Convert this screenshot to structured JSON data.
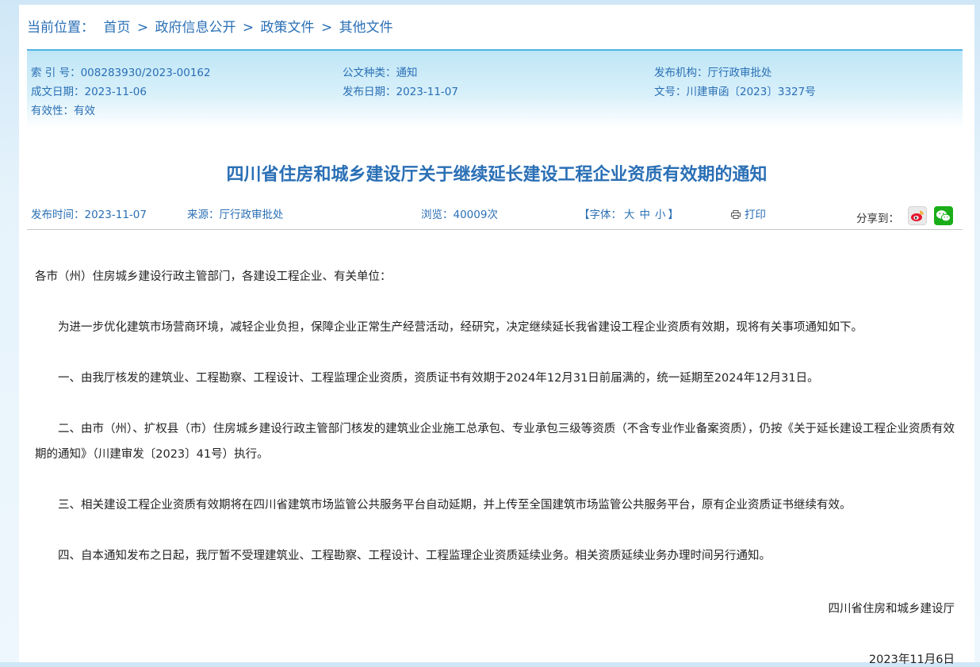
{
  "breadcrumb": {
    "label": "当前位置：",
    "items": [
      "首页",
      "政府信息公开",
      "政策文件",
      "其他文件"
    ],
    "sep": ">"
  },
  "meta": {
    "index_no": "索 引 号：008283930/2023-00162",
    "doc_type": "公文种类：通知",
    "publisher": "发布机构：厅行政审批处",
    "written_date": "成文日期：2023-11-06",
    "publish_date": "发布日期：2023-11-07",
    "doc_no": "文号：川建审函〔2023〕3327号",
    "validity": "有效性：有效"
  },
  "article": {
    "title": "四川省住房和城乡建设厅关于继续延长建设工程企业资质有效期的通知",
    "publish_time": "发布时间：2023-11-07",
    "source": "来源：厅行政审批处",
    "views": "浏览：40009次",
    "font_label_open": "【字体：",
    "font_large": "大",
    "font_medium": "中",
    "font_small": "小",
    "font_label_close": "】",
    "print_label": "打印",
    "share_label": "分享到：",
    "paragraphs": {
      "greeting": "各市（州）住房城乡建设行政主管部门，各建设工程企业、有关单位：",
      "p1": "为进一步优化建筑市场营商环境，减轻企业负担，保障企业正常生产经营活动，经研究，决定继续延长我省建设工程企业资质有效期，现将有关事项通知如下。",
      "p2": "一、由我厅核发的建筑业、工程勘察、工程设计、工程监理企业资质，资质证书有效期于2024年12月31日前届满的，统一延期至2024年12月31日。",
      "p3": "二、由市（州）、扩权县（市）住房城乡建设行政主管部门核发的建筑业企业施工总承包、专业承包三级等资质（不含专业作业备案资质），仍按《关于延长建设工程企业资质有效期的通知》（川建审发〔2023〕41号）执行。",
      "p4": "三、相关建设工程企业资质有效期将在四川省建筑市场监管公共服务平台自动延期，并上传至全国建筑市场监管公共服务平台，原有企业资质证书继续有效。",
      "p5": "四、自本通知发布之日起，我厅暂不受理建筑业、工程勘察、工程设计、工程监理企业资质延续业务。相关资质延续业务办理时间另行通知。"
    },
    "signature": "四川省住房和城乡建设厅",
    "signature_date": "2023年11月6日"
  },
  "colors": {
    "accent": "#2a6fb5",
    "meta_bar": "#4fb3e0",
    "wechat": "#1aad19",
    "weibo": "#e6162d"
  }
}
